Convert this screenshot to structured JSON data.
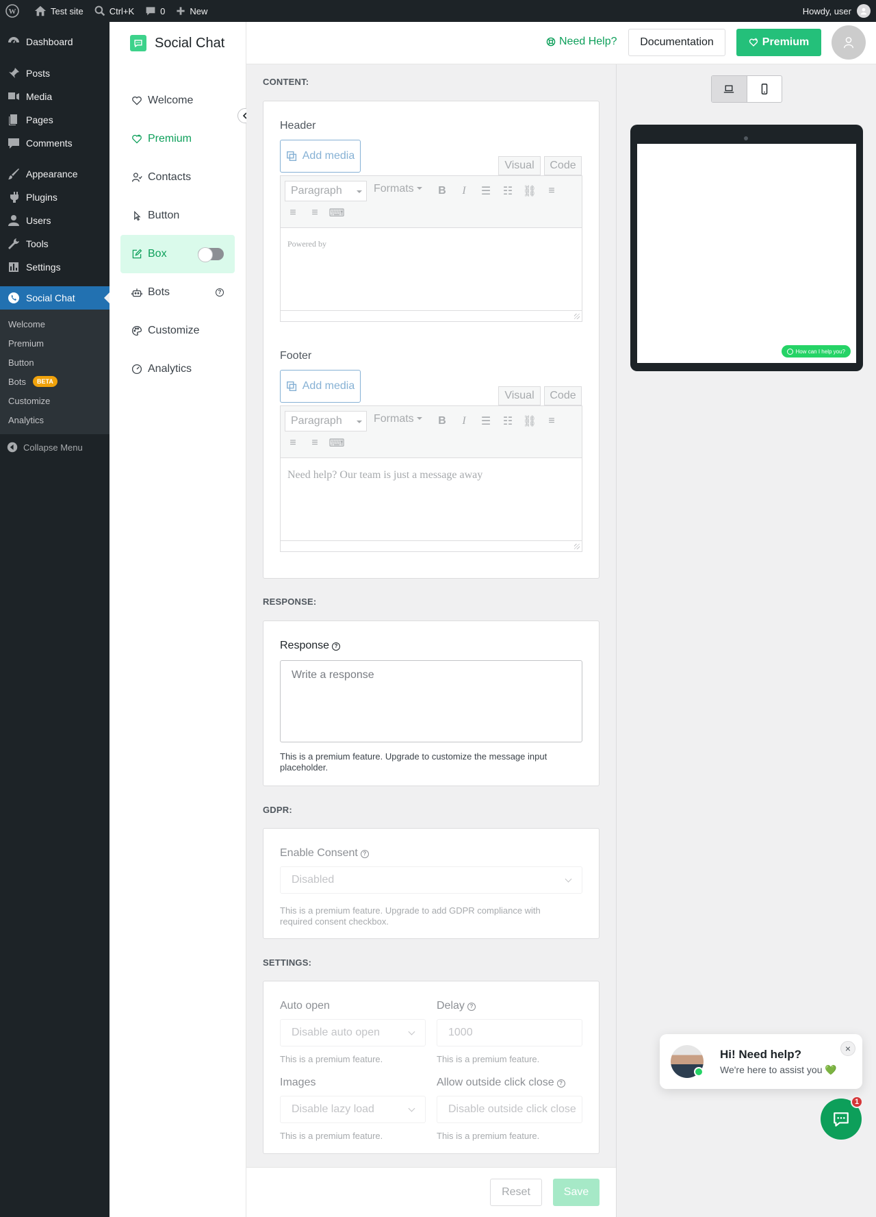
{
  "adminbar": {
    "site_name": "Test site",
    "search_shortcut": "Ctrl+K",
    "comments_count": "0",
    "new_label": "New",
    "howdy": "Howdy, user"
  },
  "adminmenu": {
    "items": [
      {
        "label": "Dashboard",
        "icon": "dashboard-icon"
      },
      {
        "label": "Posts",
        "icon": "pin-icon"
      },
      {
        "label": "Media",
        "icon": "media-icon"
      },
      {
        "label": "Pages",
        "icon": "pages-icon"
      },
      {
        "label": "Comments",
        "icon": "comments-icon"
      },
      {
        "label": "Appearance",
        "icon": "brush-icon"
      },
      {
        "label": "Plugins",
        "icon": "plug-icon"
      },
      {
        "label": "Users",
        "icon": "users-icon"
      },
      {
        "label": "Tools",
        "icon": "wrench-icon"
      },
      {
        "label": "Settings",
        "icon": "settings-icon"
      },
      {
        "label": "Social Chat",
        "icon": "whatsapp-icon"
      }
    ],
    "submenu": [
      "Welcome",
      "Premium",
      "Button",
      "Bots",
      "Customize",
      "Analytics"
    ],
    "beta_badge": "BETA",
    "collapse": "Collapse Menu"
  },
  "plugin": {
    "brand": "Social Chat",
    "nav": {
      "welcome": "Welcome",
      "premium": "Premium",
      "contacts": "Contacts",
      "button": "Button",
      "box": "Box",
      "bots": "Bots",
      "customize": "Customize",
      "analytics": "Analytics"
    },
    "box_enabled": false
  },
  "header": {
    "need_help": "Need Help?",
    "documentation": "Documentation",
    "premium": "Premium"
  },
  "content": {
    "section_title": "CONTENT:",
    "header_label": "Header",
    "footer_label": "Footer",
    "add_media": "Add media",
    "tab_visual": "Visual",
    "tab_code": "Code",
    "paragraph": "Paragraph",
    "formats": "Formats",
    "header_text": "Powered by",
    "footer_text": "Need help? Our team is just a message away"
  },
  "response": {
    "section_title": "RESPONSE:",
    "label": "Response",
    "placeholder": "Write a response",
    "hint": "This is a premium feature. Upgrade to customize the message input placeholder."
  },
  "gdpr": {
    "section_title": "GDPR:",
    "label": "Enable Consent",
    "value": "Disabled",
    "hint": "This is a premium feature. Upgrade to add GDPR compliance with required consent checkbox."
  },
  "settings": {
    "section_title": "SETTINGS:",
    "auto_open_label": "Auto open",
    "auto_open_value": "Disable auto open",
    "delay_label": "Delay",
    "delay_value": "1000",
    "images_label": "Images",
    "images_value": "Disable lazy load",
    "outside_label": "Allow outside click close",
    "outside_value": "Disable outside click close",
    "premium_hint": "This is a premium feature."
  },
  "footer": {
    "reset": "Reset",
    "save": "Save"
  },
  "preview": {
    "mini_cta": "How can I help you?",
    "popup_title": "Hi! Need help?",
    "popup_text": "We're here to assist you 💚",
    "close": "×",
    "badge_count": "1"
  },
  "colors": {
    "brand_green": "#0d9f5a",
    "premium_green": "#24c07a",
    "wp_blue": "#2271b1",
    "admin_dark": "#1d2327"
  }
}
